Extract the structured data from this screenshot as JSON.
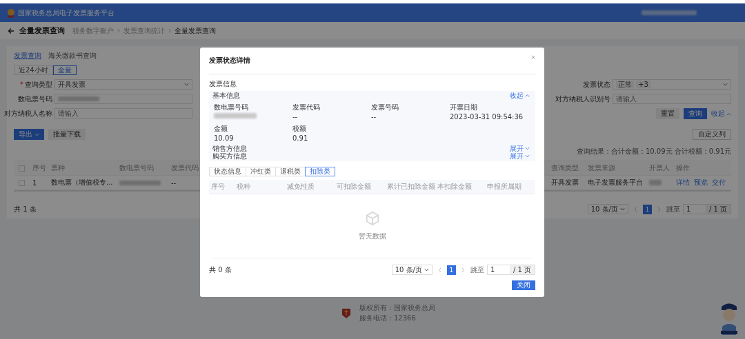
{
  "header": {
    "title": "国家税务总局电子发票服务平台"
  },
  "page": {
    "title": "全量发票查询",
    "breadcrumb": [
      "税务数字账户",
      "发票查询统计",
      "全量发票查询"
    ]
  },
  "query_tabs": [
    {
      "label": "发票查询",
      "selected": true
    },
    {
      "label": "海关缴款书查询",
      "selected": false
    }
  ],
  "time_range": [
    {
      "label": "近24小时",
      "selected": false
    },
    {
      "label": "全量",
      "selected": true
    }
  ],
  "form": {
    "left": [
      {
        "label": "查询类型",
        "mark": "*",
        "kind": "select",
        "value": "开具发票"
      },
      {
        "label": "数电票号码",
        "kind": "redacted"
      },
      {
        "label": "对方纳税人名称",
        "kind": "input",
        "placeholder": "请输入"
      }
    ],
    "right": [
      {
        "label": "发票状态",
        "kind": "tags",
        "tags": [
          "正常",
          "+3"
        ]
      },
      {
        "label": "对方纳税人识别号",
        "kind": "input",
        "placeholder": "请输入"
      }
    ],
    "reset": "重置",
    "search": "查询",
    "collapse": "收起"
  },
  "actions": {
    "export": "导出",
    "batch_download": "批量下载",
    "custom_columns": "自定义列"
  },
  "summary": "查询结果：合计金额：10.09元  合计税额：0.91元",
  "table": {
    "all_checked": false,
    "columns": [
      "序号",
      "票种",
      "数电票号码",
      "发票代码",
      "查询类型",
      "发票来源",
      "开票人",
      "操作"
    ],
    "rows": [
      {
        "checked": false,
        "index": "1",
        "type": "数电票（增值税专...",
        "code": "--",
        "query_type": "开具发票",
        "source": "电子发票服务平台",
        "actions": [
          "详情",
          "预览",
          "交付"
        ]
      }
    ]
  },
  "pagination": {
    "total": "共 1 条",
    "page_size": "10 条/页",
    "pages": [
      {
        "label": "1",
        "selected": true
      }
    ],
    "jump_label": "跳至",
    "jump_value": "1",
    "page_count": "/ 1 页"
  },
  "footer": {
    "lines": [
      "版权所有：国家税务总局",
      "服务电话：12366"
    ]
  },
  "modal": {
    "title": "发票状态详情",
    "section": "发票信息",
    "basic": {
      "title": "基本信息",
      "toggle": "收起",
      "expanded": true,
      "fields": [
        {
          "label": "数电票号码",
          "kind": "redacted"
        },
        {
          "label": "发票代码",
          "kind": "text",
          "value": "--"
        },
        {
          "label": "发票号码",
          "kind": "text",
          "value": "--"
        },
        {
          "label": "开票日期",
          "kind": "text",
          "value": "2023-03-31 09:54:36"
        },
        {
          "label": "金额",
          "kind": "text",
          "value": "10.09"
        },
        {
          "label": "税额",
          "kind": "text",
          "value": "0.91"
        }
      ]
    },
    "groups": [
      {
        "title": "销售方信息",
        "toggle": "展开",
        "expanded": false
      },
      {
        "title": "购买方信息",
        "toggle": "展开",
        "expanded": false
      }
    ],
    "tabs": [
      {
        "label": "状态信息",
        "selected": false
      },
      {
        "label": "冲红类",
        "selected": false
      },
      {
        "label": "退税类",
        "selected": false
      },
      {
        "label": "扣除类",
        "selected": true
      }
    ],
    "columns": [
      "序号",
      "税种",
      "减免性质",
      "可扣除金额",
      "累计已扣除金额",
      "本扣除金额",
      "申报所属期"
    ],
    "empty": "暂无数据",
    "pagination": {
      "total": "共 0 条",
      "page_size": "10 条/页",
      "pages": [
        {
          "label": "1",
          "selected": true
        }
      ],
      "jump_label": "跳至",
      "jump_value": "1",
      "page_count": "/ 1 页"
    },
    "close": "关闭"
  }
}
